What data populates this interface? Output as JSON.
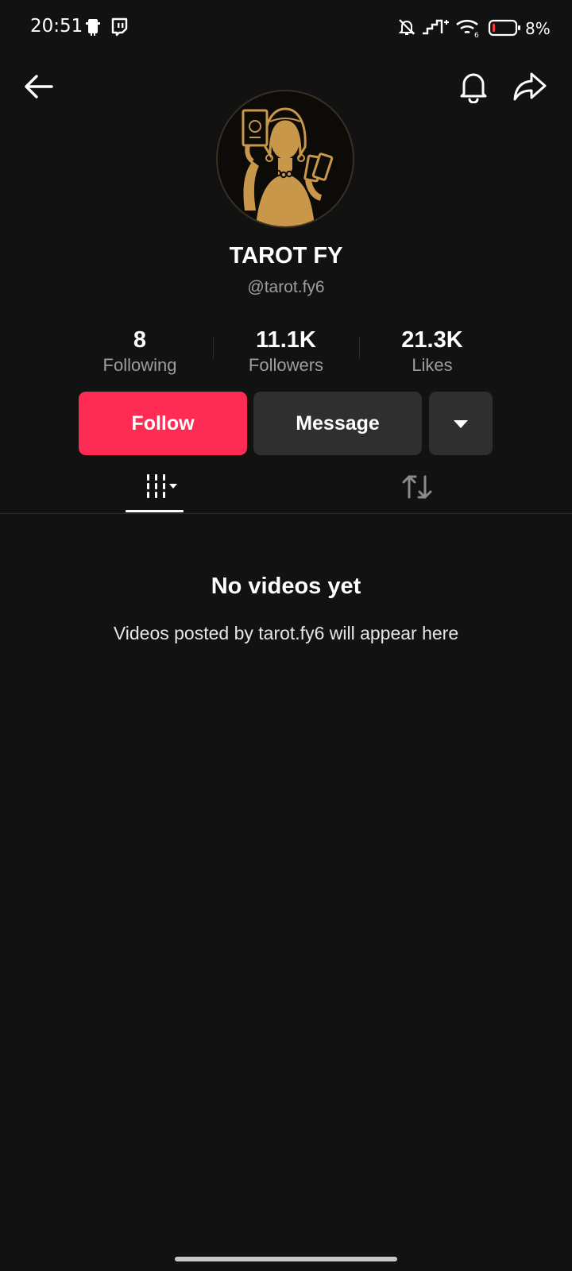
{
  "status_bar": {
    "time": "20:51",
    "battery_percent": "8%",
    "icons": [
      "notification-icon",
      "twitch-icon",
      "mute-icon",
      "signal-icon",
      "wifi-icon",
      "battery-icon"
    ]
  },
  "header": {
    "back_icon": "arrow-left-icon",
    "bell_icon": "bell-icon",
    "share_icon": "share-icon"
  },
  "profile": {
    "display_name": "TAROT FY",
    "handle": "@tarot.fy6",
    "avatar": "tarot-reader-avatar"
  },
  "stats": [
    {
      "value": "8",
      "label": "Following"
    },
    {
      "value": "11.1K",
      "label": "Followers"
    },
    {
      "value": "21.3K",
      "label": "Likes"
    }
  ],
  "actions": {
    "follow_label": "Follow",
    "message_label": "Message",
    "more_icon": "caret-down-icon"
  },
  "tabs": [
    {
      "icon": "videos-grid-icon",
      "selected": true
    },
    {
      "icon": "repost-icon",
      "selected": false
    }
  ],
  "empty_state": {
    "title": "No videos yet",
    "subtitle": "Videos posted by tarot.fy6 will appear here"
  },
  "colors": {
    "background": "#121212",
    "accent": "#fe2c55",
    "secondary_button": "#2f2f2f",
    "avatar_gold": "#c9974a"
  }
}
